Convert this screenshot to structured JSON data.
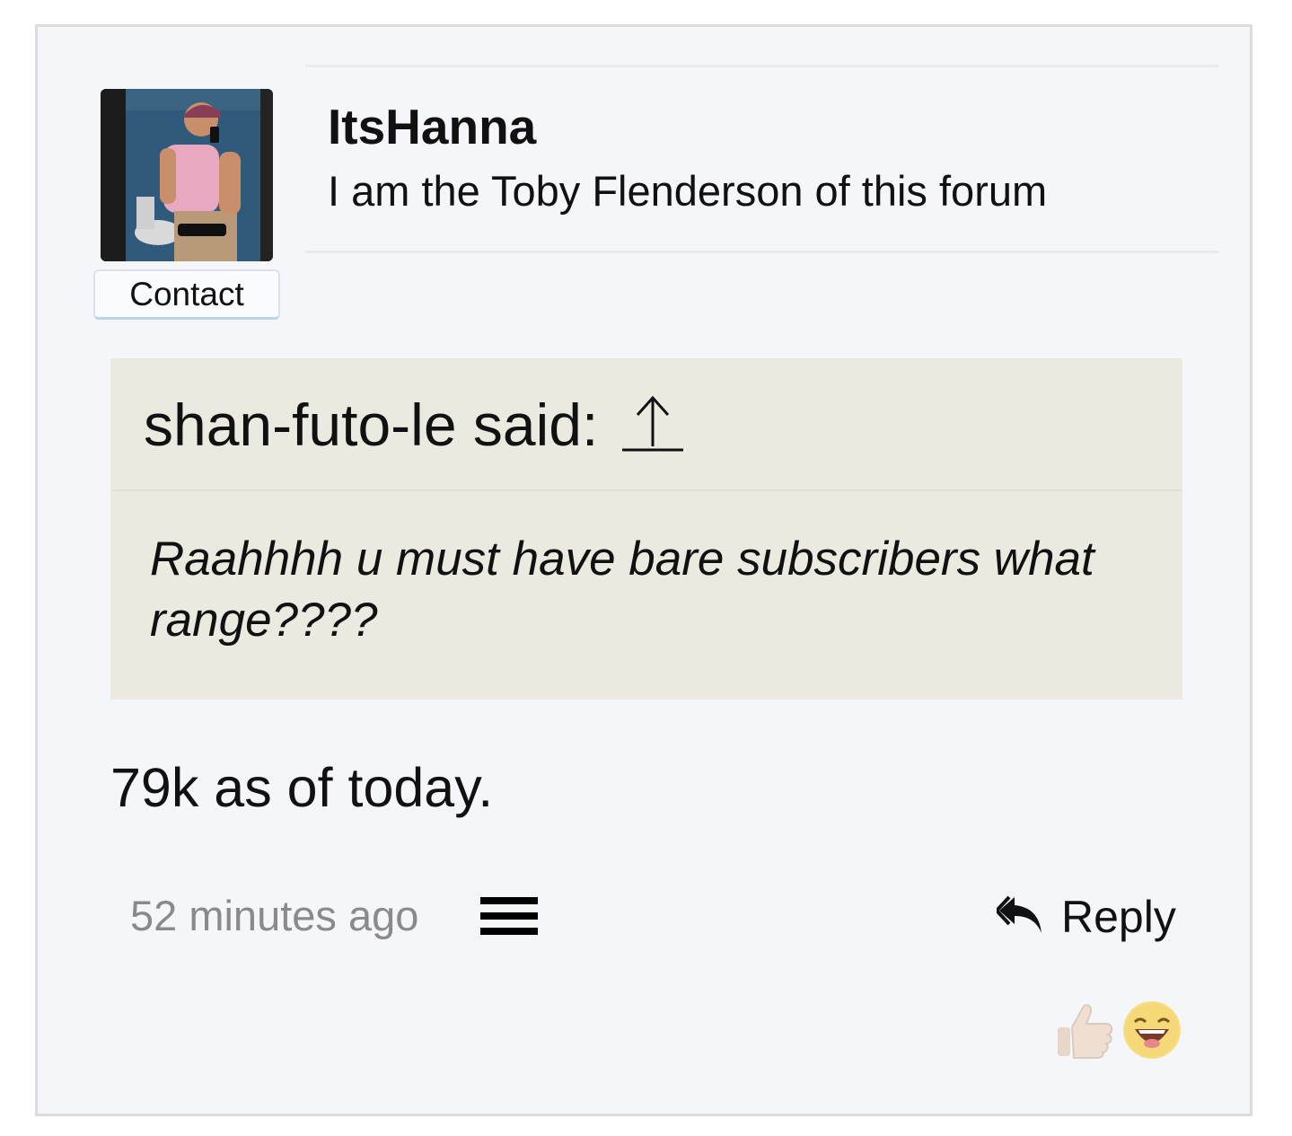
{
  "user": {
    "name": "ItsHanna",
    "title": "I am the Toby Flenderson of this forum",
    "contact_label": "Contact"
  },
  "quote": {
    "attribution": "shan-futo-le said:",
    "text": "Raahhhh u must have bare subscribers what range????"
  },
  "post": {
    "message": "79k as of today.",
    "timestamp": "52 minutes ago",
    "reply_label": "Reply"
  },
  "icons": {
    "menu": "hamburger-menu-icon",
    "reply": "reply-arrow-icon",
    "quote_jump": "up-arrow-icon",
    "reactions": [
      "thumbs-up-icon",
      "laughing-face-icon"
    ]
  },
  "colors": {
    "post_background": "#f5f6fa",
    "quote_background": "#ebeae0",
    "timestamp": "#8a8a8a",
    "contact_accent": "#b8d5ea"
  }
}
